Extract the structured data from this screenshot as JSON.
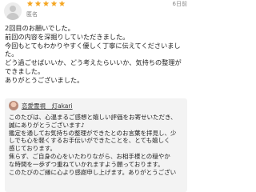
{
  "review": {
    "date": "6日前",
    "author": "匿名",
    "rating": 5,
    "star_color": "#f5a623",
    "avatar_icon": "user-avatar-icon",
    "lines": [
      "2回目のお願いでした。",
      "前回の内容を深掘りしていただきました。",
      "今回もとてもわかりやすく優しく丁寧に伝えてくださいまし",
      "た。",
      "どう過ごせばいいか、どう考えたらいいか、気持ちの整理が",
      "できました。",
      "ありがとうございました。"
    ]
  },
  "reply": {
    "shop_name": "恋愛霊視　灯akari",
    "lines": [
      "このたびは、心温まるご感想と嬉しい評価をお寄せいただき、",
      "誠にありがとうございます♪",
      "鑑定を通してお気持ちの整理ができたとのお言葉を拝見し、少",
      "しでも心を軽くするお手伝いができたことを、とても嬉しく",
      "感じております。",
      "焦らず、ご自身の心をいたわりながら、お相手様との穏やか",
      "な時間を一歩ずつ重ねていかれますよう願っております。",
      "このたびのご縁に心より感謝申し上げます。ありがとうござい"
    ]
  }
}
